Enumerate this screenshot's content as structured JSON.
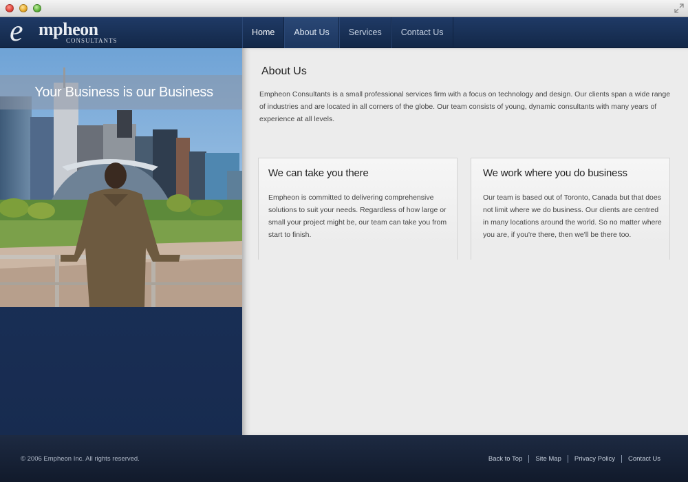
{
  "logo": {
    "letter": "e",
    "word": "mpheon",
    "tagline": "CONSULTANTS"
  },
  "nav": {
    "items": [
      {
        "label": "Home"
      },
      {
        "label": "About Us"
      },
      {
        "label": "Services"
      },
      {
        "label": "Contact Us"
      }
    ],
    "active": "About Us"
  },
  "hero": {
    "banner": "Your Business is our Business"
  },
  "main": {
    "title": "About Us",
    "intro": "Empheon Consultants is a small professional services firm with a focus on technology and design. Our clients span a wide range of industries and are located in all corners of the globe. Our team consists of young, dynamic consultants with many years of experience at all levels.",
    "cards": [
      {
        "title": "We can take you there",
        "body": "Empheon is committed to delivering comprehensive solutions to suit your needs. Regardless of how large or small your project might be, our team can take you from start to finish."
      },
      {
        "title": "We work where you do business",
        "body": "Our team is based out of Toronto, Canada but that does not limit where we do business. Our clients are centred in many locations around the world. So no matter where you are, if you're there, then we'll be there too."
      }
    ]
  },
  "footer": {
    "copyright": "© 2006 Empheon Inc.  All rights reserved.",
    "links": [
      {
        "label": "Back to Top"
      },
      {
        "label": "Site Map"
      },
      {
        "label": "Privacy Policy"
      },
      {
        "label": "Contact Us"
      }
    ]
  },
  "colors": {
    "header": "#1a3158",
    "footer": "#162137",
    "content": "#ececec"
  }
}
